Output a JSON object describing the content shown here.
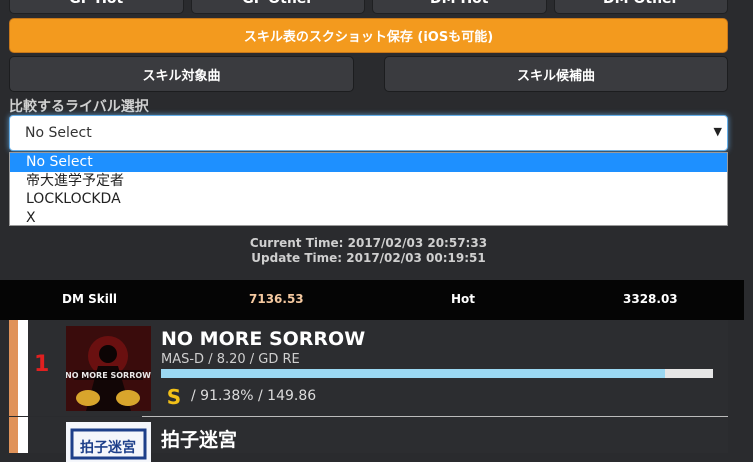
{
  "nav_tabs": [
    "GF Hot",
    "GF Other",
    "DM Hot",
    "DM Other"
  ],
  "screenshot_button": "スキル表のスクショット保存 (iOSも可能)",
  "skill_target_button": "スキル対象曲",
  "skill_candidate_button": "スキル候補曲",
  "rival": {
    "label": "比較するライバル選択",
    "selected": "No Select",
    "options": [
      "No Select",
      "帝大進学予定者",
      "LOCKLOCKDA",
      "X"
    ]
  },
  "times": {
    "current": "Current Time: 2017/02/03 20:57:33",
    "update": "Update Time: 2017/02/03 00:19:51"
  },
  "skill_bar": {
    "label": "DM Skill",
    "value": "7136.53",
    "hot_label": "Hot",
    "hot_value": "3328.03"
  },
  "songs": [
    {
      "rank": "1",
      "title": "NO MORE SORROW",
      "meta": "MAS-D / 8.20 / GD RE",
      "achievement_fraction": 0.9138,
      "rank_badge": "S",
      "score": "/ 91.38% / 149.86",
      "jacket_text": "NO MORE SORROW"
    },
    {
      "title": "拍子迷宮",
      "jacket_text": "拍子迷宮"
    }
  ],
  "colors": {
    "accent_orange": "#f39a1e",
    "select_highlight": "#1e90ff",
    "skill_value": "#f5c9a0",
    "rank_red": "#e02020",
    "progress_fill": "#9bd8f2"
  }
}
